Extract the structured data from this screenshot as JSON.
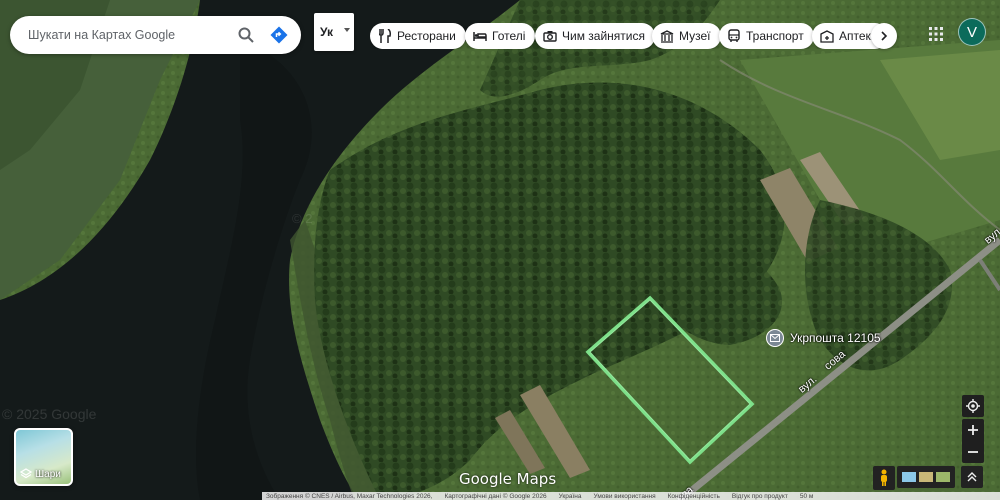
{
  "search": {
    "placeholder": "Шукати на Картах Google"
  },
  "language": {
    "selected": "Ук"
  },
  "chips": [
    {
      "label": "Ресторани",
      "icon": "fork-knife-icon"
    },
    {
      "label": "Готелі",
      "icon": "bed-icon"
    },
    {
      "label": "Чим зайнятися",
      "icon": "camera-icon"
    },
    {
      "label": "Музеї",
      "icon": "museum-icon"
    },
    {
      "label": "Транспорт",
      "icon": "bus-icon"
    },
    {
      "label": "Аптеки",
      "icon": "pharmacy-icon"
    }
  ],
  "account": {
    "initial": "V",
    "color": "#0b6b5b"
  },
  "map": {
    "poi_label": "Укрпошта 12105",
    "street_label_1": "вул.",
    "street_label_2": "сова",
    "street_label_3": "вул",
    "street_label_4": "ова",
    "faint_copyright": "© 2025 Google",
    "faint_copyright_2": "© 2",
    "highlight_color": "#7ee08a"
  },
  "layers": {
    "label": "Шари"
  },
  "logo": {
    "text": "Google Maps"
  },
  "footer": {
    "imagery": "Зображення © CNES / Airbus, Maxar Technologies 2026,",
    "mapdata": "Картографічні дані © Google 2026",
    "country": "Україна",
    "terms": "Умови використання",
    "privacy": "Конфіденційність",
    "feedback": "Відгук про продукт",
    "scale": "50 м"
  }
}
